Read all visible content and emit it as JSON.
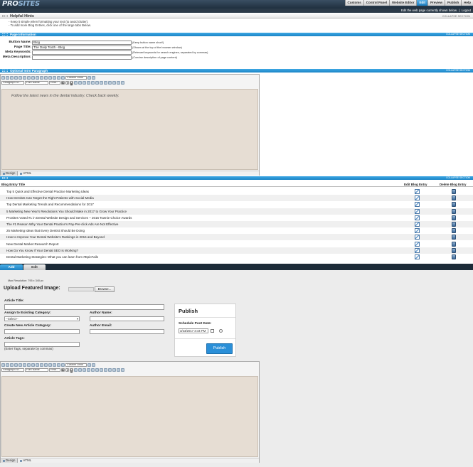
{
  "topbar": {
    "logo_pro": "PRO",
    "logo_sites": "SITES",
    "nav": [
      "Customs",
      "Control Panel",
      "Website Editor",
      "Edit",
      "Preview",
      "Publish",
      "Help"
    ],
    "active_nav": "Edit",
    "status_text": "Edit the web page currently shown below.",
    "logout_label": "Logout"
  },
  "hints": {
    "title": "Helpful Hints",
    "collapse_label": "COLLAPSE SECTION",
    "items": [
      "Keep it simple when formatting your text (to avoid clutter).",
      "To add more Blog Entries, click one of the large tabs Below."
    ]
  },
  "page_info": {
    "title": "Page Information",
    "collapse_label": "COLLAPSE SECTION",
    "fields": [
      {
        "label": "Button Name:",
        "value": "Blog",
        "help": "(Keep button name short!)"
      },
      {
        "label": "Page Title:",
        "value": "The Daily Tooth - Blog",
        "help": "(Shown at the top of the browser window)"
      },
      {
        "label": "Meta Keywords:",
        "value": "",
        "help": "(Relevant keywords for search engines, separated by commas)"
      },
      {
        "label": "Meta Description:",
        "value": "",
        "help": "(Concise description of page content)"
      }
    ]
  },
  "intro": {
    "title": "Optional Intro Paragraph",
    "collapse_label": "COLLAPSE SECTION",
    "text": "Follow the latest news in the dental industry.  Check back weekly.",
    "toolbar": {
      "paragraph_style": "Paragraph St...",
      "font_name": "Font Name",
      "font_size": "Real...",
      "custom_links": "Custom Links"
    },
    "tab_design": "Design",
    "tab_html": "HTML"
  },
  "blog_list": {
    "collapse_label": "COLLAPSE SECTION",
    "col_title": "Blog Entry Title",
    "col_edit": "Edit Blog Entry",
    "col_delete": "Delete Blog Entry",
    "entries": [
      "Top 5 Quick and Effective Dental Practice Marketing Ideas",
      "How Dentists Can Target the Right Patients with Social Media",
      "Top Dental Marketing Trends and Recommendations for 2017",
      "5 Marketing New Year's Resolutions You Should Make in 2017 to Grow Your Practice",
      "ProSites Voted #1 in Dental Website Design and Services – 2016 Townie Choice Awards",
      "The #1 Reason Why Your Dental Practice's Pay-Per-click Ads Are Not Effective",
      "25 Marketing Ideas that Every Dentist Should Be Doing",
      "How to Improve Your Dental Website's Rankings in 2016 and Beyond",
      "New Dental Market Research Report",
      "How Do You Know If Your Dental SEO is Working?",
      "Dental Marketing Strategies: What you can learn from #EpicFails"
    ]
  },
  "add_tabs": {
    "add": "Add",
    "edit": "Edit"
  },
  "add_form": {
    "max_resolution": "Max Resolution: 795 x 340 px",
    "upload_label": "Upload Featured Image:",
    "browse_label": "Browse...",
    "article_title_label": "Article Title:",
    "category_label": "Assign to Existing Category:",
    "category_value": "--Select--",
    "author_name_label": "Author Name:",
    "new_category_label": "Create New Article Category:",
    "author_email_label": "Author Email:",
    "tags_label": "Article Tags:",
    "tags_help": "(Enter Tags, separate by commas)",
    "publish": {
      "title": "Publish",
      "schedule_label": "Schedule Post Date:",
      "date_value": "3/23/2017 3:44 PM",
      "button": "Publish"
    },
    "toolbar": {
      "paragraph_style": "Paragraph St...",
      "font_name": "Font Name",
      "font_size": "Real...",
      "custom_links": "Custom Links"
    },
    "tab_design": "Design",
    "tab_html": "HTML"
  }
}
